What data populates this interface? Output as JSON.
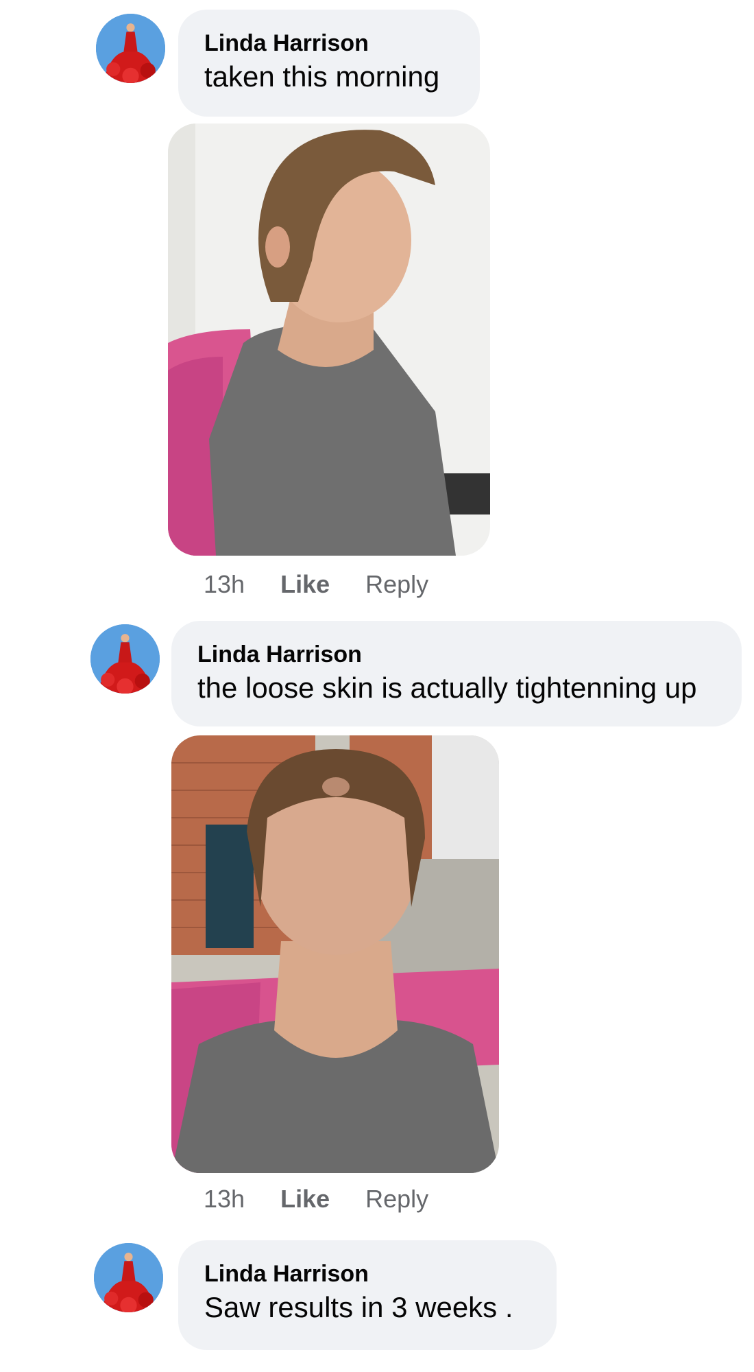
{
  "comments": [
    {
      "author": "Linda Harrison",
      "text": "taken this morning",
      "photo_icon": "profile-photo",
      "time": "13h",
      "like_label": "Like",
      "reply_label": "Reply"
    },
    {
      "author": "Linda Harrison",
      "text": "the loose skin is actually tightenning up",
      "photo_icon": "chin-up-photo",
      "time": "13h",
      "like_label": "Like",
      "reply_label": "Reply"
    },
    {
      "author": "Linda Harrison",
      "text": "Saw results in 3 weeks ."
    }
  ],
  "colors": {
    "bubble": "#f0f2f5",
    "meta": "#65676b",
    "avatar_bg": "#4a8fd6",
    "dress": "#d11a1a"
  }
}
